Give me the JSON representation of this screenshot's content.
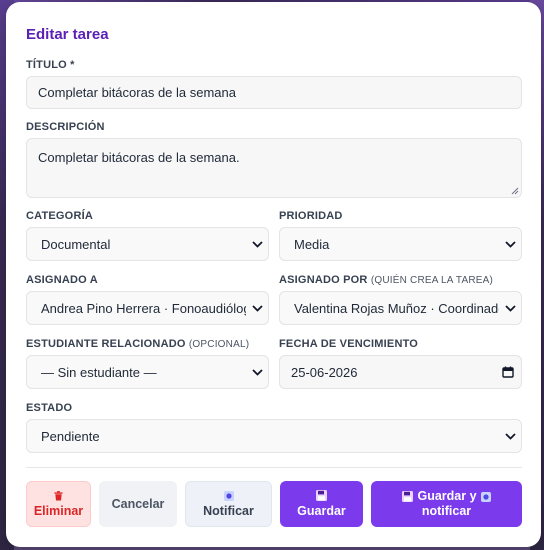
{
  "modal": {
    "title": "Editar tarea"
  },
  "form": {
    "titulo": {
      "label": "TÍTULO *",
      "value": "Completar bitácoras de la semana"
    },
    "descripcion": {
      "label": "DESCRIPCIÓN",
      "value": "Completar bitácoras de la semana."
    },
    "categoria": {
      "label": "CATEGORÍA",
      "value": "Documental"
    },
    "prioridad": {
      "label": "PRIORIDAD",
      "value": "Media"
    },
    "asignado_a": {
      "label": "ASIGNADO A",
      "value": "Andrea Pino Herrera · Fonoaudiólogo/a"
    },
    "asignado_por": {
      "label": "ASIGNADO POR",
      "hint": "(QUIÉN CREA LA TAREA)",
      "value": "Valentina Rojas Muñoz · Coordinador/a"
    },
    "estudiante": {
      "label": "ESTUDIANTE RELACIONADO",
      "hint": "(OPCIONAL)",
      "value": "— Sin estudiante —"
    },
    "fecha": {
      "label": "FECHA DE VENCIMIENTO",
      "value": "25-06-2026"
    },
    "estado": {
      "label": "ESTADO",
      "value": "Pendiente"
    }
  },
  "buttons": {
    "eliminar": "Eliminar",
    "cancelar": "Cancelar",
    "notificar": "Notificar",
    "guardar": "Guardar",
    "guardar_notificar_1": "Guardar y",
    "guardar_notificar_2": "notificar"
  },
  "colors": {
    "accent": "#7c3aed",
    "title": "#5b21b6",
    "danger": "#dc2626",
    "danger_bg": "#fee2e2"
  },
  "icons": [
    "trash-icon",
    "bell-icon",
    "floppy-disk-icon",
    "chevron-down-icon",
    "calendar-icon"
  ]
}
